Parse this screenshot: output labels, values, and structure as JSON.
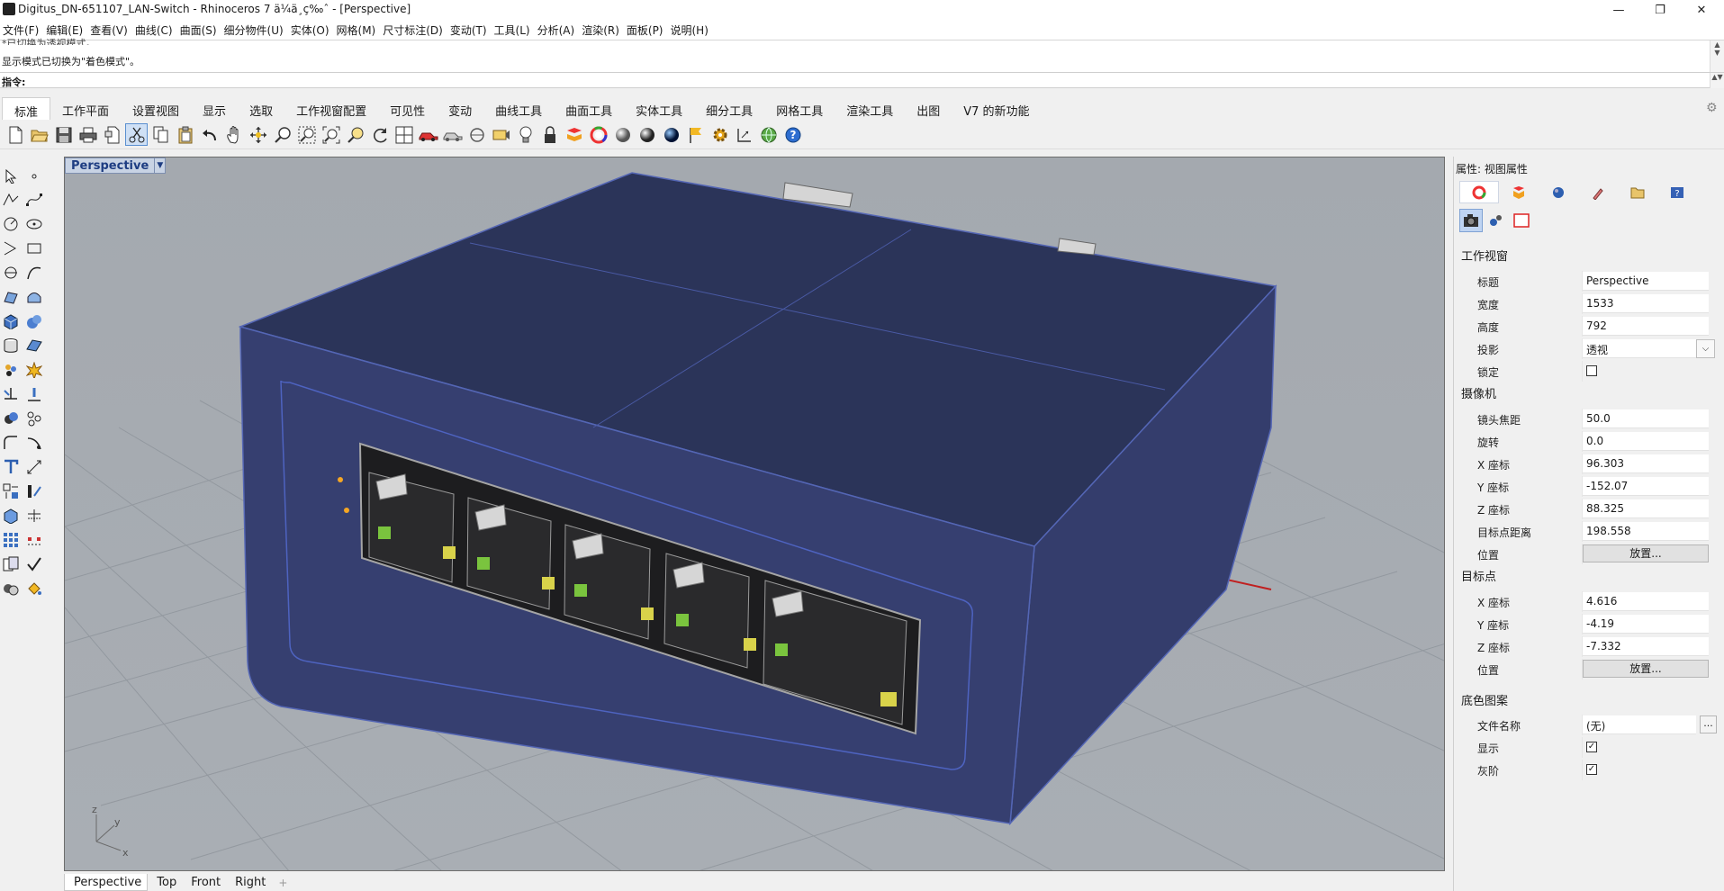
{
  "window": {
    "title": "Digitus_DN-651107_LAN-Switch - Rhinoceros 7 ä¼ä¸ç‰ˆ - [Perspective]",
    "minimize": "—",
    "maximize": "❐",
    "close": "✕"
  },
  "menu": [
    "文件(F)",
    "编辑(E)",
    "查看(V)",
    "曲线(C)",
    "曲面(S)",
    "细分物件(U)",
    "实体(O)",
    "网格(M)",
    "尺寸标注(D)",
    "变动(T)",
    "工具(L)",
    "分析(A)",
    "渲染(R)",
    "面板(P)",
    "说明(H)"
  ],
  "command": {
    "history_partial": "*已切换为透视模式。",
    "history_last": "显示模式已切换为\"着色模式\"。",
    "prompt_label": "指令:",
    "input_value": ""
  },
  "tabs": [
    "标准",
    "工作平面",
    "设置视图",
    "显示",
    "选取",
    "工作视窗配置",
    "可见性",
    "变动",
    "曲线工具",
    "曲面工具",
    "实体工具",
    "细分工具",
    "网格工具",
    "渲染工具",
    "出图",
    "V7 的新功能"
  ],
  "active_tab": "标准",
  "toolbar_icons": [
    "new-file-icon",
    "open-folder-icon",
    "save-icon",
    "print-icon",
    "import-icon",
    "cut-icon",
    "copy-icon",
    "paste-icon",
    "undo-icon",
    "pan-hand-icon",
    "move-view-icon",
    "zoom-icon",
    "zoom-window-icon",
    "zoom-extents-icon",
    "zoom-selected-icon",
    "rotate-view-icon",
    "four-viewports-icon",
    "car-icon",
    "shaded-car-icon",
    "camera-icon",
    "named-view-icon",
    "light-bulb-icon",
    "lock-icon",
    "layer-icon",
    "color-wheel-icon",
    "material-sphere-icon",
    "render-sphere-icon",
    "blue-sphere-icon",
    "flag-icon",
    "gear-settings-icon",
    "dimension-icon",
    "globe-icon",
    "help-icon"
  ],
  "viewport": {
    "label": "Perspective",
    "axis_labels": {
      "z": "z",
      "y": "y",
      "x": "x"
    }
  },
  "viewport_tabs": [
    "Perspective",
    "Top",
    "Front",
    "Right"
  ],
  "viewport_add": "+",
  "active_viewport_tab": "Perspective",
  "panel": {
    "title": "属性: 视图属性",
    "section_viewport": "工作视窗",
    "section_camera": "摄像机",
    "section_target": "目标点",
    "section_wallpaper": "底色图案",
    "rows": {
      "title": {
        "label": "标题",
        "value": "Perspective"
      },
      "width": {
        "label": "宽度",
        "value": "1533"
      },
      "height": {
        "label": "高度",
        "value": "792"
      },
      "projection": {
        "label": "投影",
        "value": "透视"
      },
      "locked": {
        "label": "锁定",
        "checked": false
      },
      "lens": {
        "label": "镜头焦距",
        "value": "50.0"
      },
      "rotation": {
        "label": "旋转",
        "value": "0.0"
      },
      "cam_x": {
        "label": "X 座标",
        "value": "96.303"
      },
      "cam_y": {
        "label": "Y 座标",
        "value": "-152.07"
      },
      "cam_z": {
        "label": "Z 座标",
        "value": "88.325"
      },
      "target_distance": {
        "label": "目标点距离",
        "value": "198.558"
      },
      "cam_position": {
        "label": "位置",
        "button": "放置..."
      },
      "tgt_x": {
        "label": "X 座标",
        "value": "4.616"
      },
      "tgt_y": {
        "label": "Y 座标",
        "value": "-4.19"
      },
      "tgt_z": {
        "label": "Z 座标",
        "value": "-7.332"
      },
      "tgt_position": {
        "label": "位置",
        "button": "放置..."
      },
      "filename": {
        "label": "文件名称",
        "value": "(无)",
        "button": "..."
      },
      "show": {
        "label": "显示",
        "checked": true
      },
      "grayscale": {
        "label": "灰阶",
        "checked": true
      }
    }
  },
  "check_mark": "✓"
}
